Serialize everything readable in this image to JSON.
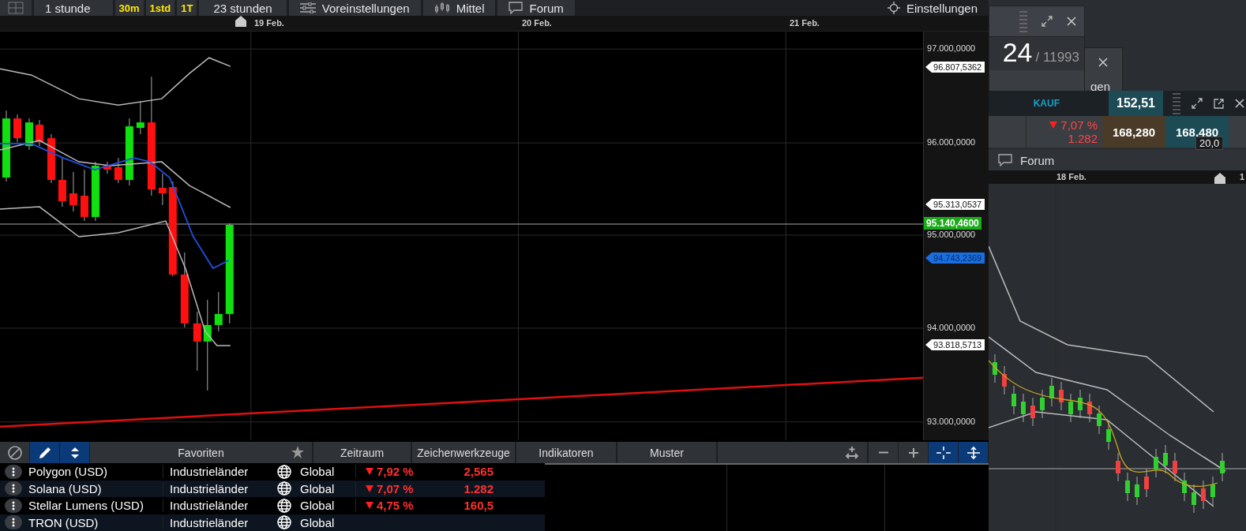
{
  "toolbar": {
    "interval": "1 stunde",
    "quick": [
      "30m",
      "1std",
      "1T"
    ],
    "range": "23 stunden",
    "buttons": [
      {
        "kind": "presets",
        "label": "Voreinstellungen"
      },
      {
        "kind": "style",
        "label": "Mittel"
      },
      {
        "kind": "forum",
        "label": "Forum"
      }
    ],
    "settings": "Einstellungen"
  },
  "chart": {
    "dates": [
      "19 Feb.",
      "20 Feb.",
      "21 Feb."
    ],
    "price_axis": [
      "97.000,0000",
      "96.000,0000",
      "95.000,0000",
      "94.000,0000",
      "93.000,0000"
    ],
    "price_tags": [
      {
        "kind": "band",
        "label": "96.807,5362"
      },
      {
        "kind": "band",
        "label": "95.313,0537"
      },
      {
        "kind": "last",
        "label": "95.140,4600"
      },
      {
        "kind": "average",
        "label": "94.743,2369"
      },
      {
        "kind": "band",
        "label": "93.818,5713"
      }
    ]
  },
  "bottom_toolbar": {
    "tools": [
      {
        "kind": "cancel",
        "selected": false
      },
      {
        "kind": "draw",
        "selected": true
      },
      {
        "kind": "sort",
        "selected": true
      }
    ],
    "tabs": [
      "Favoriten",
      "Zeitraum",
      "Zeichenwerkzeuge",
      "Indikatoren",
      "Muster"
    ],
    "zoom_tools": [
      {
        "kind": "move",
        "selected": false
      },
      {
        "kind": "minus",
        "selected": false
      },
      {
        "kind": "plus",
        "selected": false
      },
      {
        "kind": "crosshair",
        "selected": true
      },
      {
        "kind": "fit",
        "selected": true
      }
    ]
  },
  "table": {
    "rows": [
      {
        "name": "Polygon (USD)",
        "market": "Industrieländer",
        "region": "Global",
        "change": "7,92 %",
        "value": "2,565"
      },
      {
        "name": "Solana (USD)",
        "market": "Industrieländer",
        "region": "Global",
        "change": "7,07 %",
        "value": "1.282"
      },
      {
        "name": "Stellar Lumens (USD)",
        "market": "Industrieländer",
        "region": "Global",
        "change": "4,75 %",
        "value": "160,5"
      },
      {
        "name": "TRON (USD)",
        "market": "Industrieländer",
        "region": "Global"
      }
    ]
  },
  "side_panels": {
    "counter": {
      "value": "24",
      "total": "/ 11993"
    },
    "back_panel": {
      "label": "gen"
    },
    "quote": {
      "side": "KAUF",
      "price": "152,51",
      "change": "7,07 %",
      "change_value": "1.282",
      "bid": "168,280",
      "ask": "168,480",
      "spread": "20,0"
    },
    "forum": "Forum",
    "dates": [
      "18 Feb.",
      "1"
    ]
  }
}
